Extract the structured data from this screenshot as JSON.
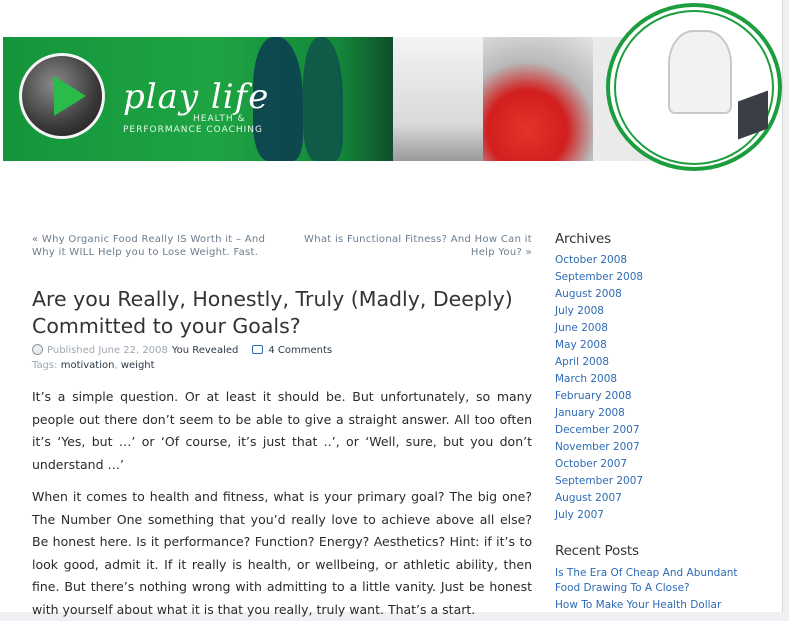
{
  "header": {
    "brand_title": "play life",
    "brand_sub_line1": "HEALTH &",
    "brand_sub_line2": "PERFORMANCE COACHING",
    "accent_green": "#1a9a3c"
  },
  "post_nav": {
    "prev": "« Why Organic Food Really IS Worth it – And Why it WILL Help you to Lose Weight. Fast.",
    "next": "What is Functional Fitness? And How Can it Help You? »"
  },
  "post": {
    "title": "Are you Really, Honestly, Truly (Madly, Deeply) Committed to your Goals?",
    "published_label": "Published June 22, 2008",
    "author": "You Revealed",
    "comments": "4 Comments",
    "tags_label": "Tags:",
    "tags": [
      "motivation",
      "weight"
    ],
    "paragraphs": [
      "It’s a simple question. Or at least it should be. But unfortunately, so many people out there don’t seem to be able to give a straight answer. All too often it’s ‘Yes, but …’ or ‘Of course, it’s just that ..’, or ‘Well, sure, but you don’t understand …’",
      "When it comes to health and fitness, what is your primary goal? The big one? The Number One something that you’d really love to achieve above all else? Be honest here. Is it performance? Function? Energy? Aesthetics? Hint: if it’s to look good, admit it. If it really is health, or wellbeing, or athletic ability, then fine. But there’s nothing wrong with admitting to a little vanity. Just be honest with yourself about what it is that you really, truly want. That’s a start."
    ]
  },
  "sidebar": {
    "archives_heading": "Archives",
    "archives": [
      "October 2008",
      "September 2008",
      "August 2008",
      "July 2008",
      "June 2008",
      "May 2008",
      "April 2008",
      "March 2008",
      "February 2008",
      "January 2008",
      "December 2007",
      "November 2007",
      "October 2007",
      "September 2007",
      "August 2007",
      "July 2007"
    ],
    "recent_heading": "Recent Posts",
    "recent": [
      "Is The Era Of Cheap And Abundant Food Drawing To A Close?",
      "How To Make Your Health Dollar"
    ],
    "link_color": "#2d6bb4"
  }
}
